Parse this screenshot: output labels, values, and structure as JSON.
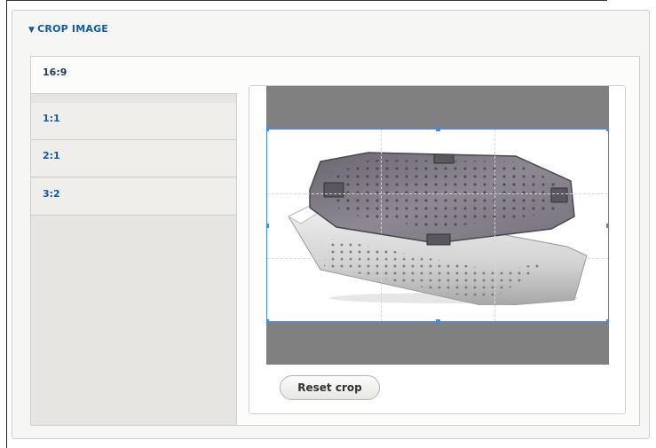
{
  "section": {
    "title": "CROP IMAGE",
    "toggle_icon": "triangle-down-icon"
  },
  "tabs": [
    {
      "label": "16:9",
      "active": true
    },
    {
      "label": "1:1",
      "active": false
    },
    {
      "label": "2:1",
      "active": false
    },
    {
      "label": "3:2",
      "active": false
    }
  ],
  "cropper": {
    "image_subject": "perforated steel sterilization basket with transparent lid",
    "selection_color": "#3e8cf0",
    "overlay_color": "#808080"
  },
  "actions": {
    "reset_label": "Reset crop"
  }
}
